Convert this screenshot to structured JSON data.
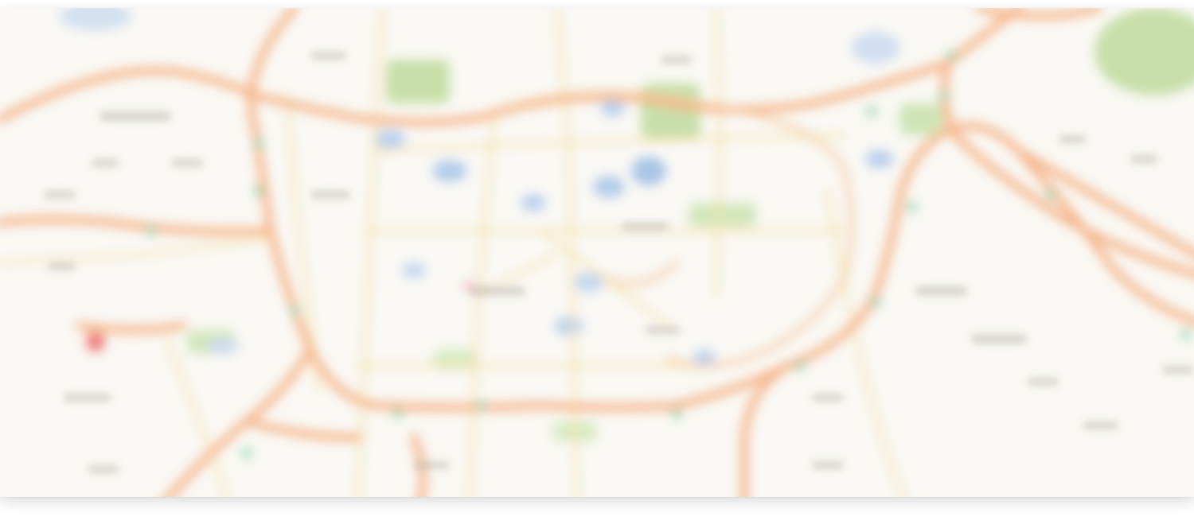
{
  "map": {
    "style": "blurred city street map",
    "colors": {
      "land": "#f9f8f4",
      "major_road": "#f7b486",
      "minor_road": "#f5e6b3",
      "park": "#c5dfa8",
      "water": "#a7c4e6",
      "transit": "#8ccfa8",
      "marker_red": "#ef7b7b",
      "label": "#b9b4ac"
    }
  }
}
